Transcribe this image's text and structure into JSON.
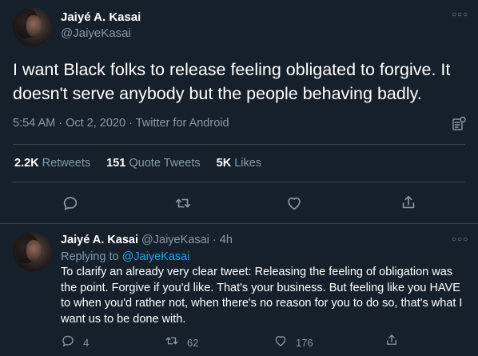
{
  "tweet": {
    "author_name": "Jaiyé A. Kasai",
    "handle": "@JaiyeKasai",
    "text": "I want Black folks to release feeling obligated to forgive. It doesn't serve anybody but the people behaving badly.",
    "time": "5:54 AM",
    "separator": " · ",
    "date": "Oct 2, 2020",
    "source": "Twitter for Android",
    "stats": {
      "retweets_count": "2.2K",
      "retweets_label": "Retweets",
      "quotes_count": "151",
      "quotes_label": "Quote Tweets",
      "likes_count": "5K",
      "likes_label": "Likes"
    }
  },
  "reply": {
    "author_name": "Jaiyé A. Kasai",
    "handle": "@JaiyeKasai",
    "separator": "·",
    "time_ago": "4h",
    "replying_to_label": "Replying to",
    "replying_to_handle": "@JaiyeKasai",
    "text": "To clarify an already very clear tweet: Releasing the feeling of obligation was the point. Forgive if you'd like. That's your business. But feeling like you HAVE to when you'd rather not, when there's no reason for you to do so, that's what I want us to be done with.",
    "reply_count": "4",
    "retweet_count": "62",
    "like_count": "176"
  },
  "icons": [
    "more-icon",
    "analytics-icon",
    "reply-icon",
    "retweet-icon",
    "like-icon",
    "share-icon"
  ],
  "colors": {
    "background": "#15202b",
    "text": "#ffffff",
    "muted": "#8899a6",
    "accent": "#1da1f2",
    "divider": "#38444d"
  }
}
